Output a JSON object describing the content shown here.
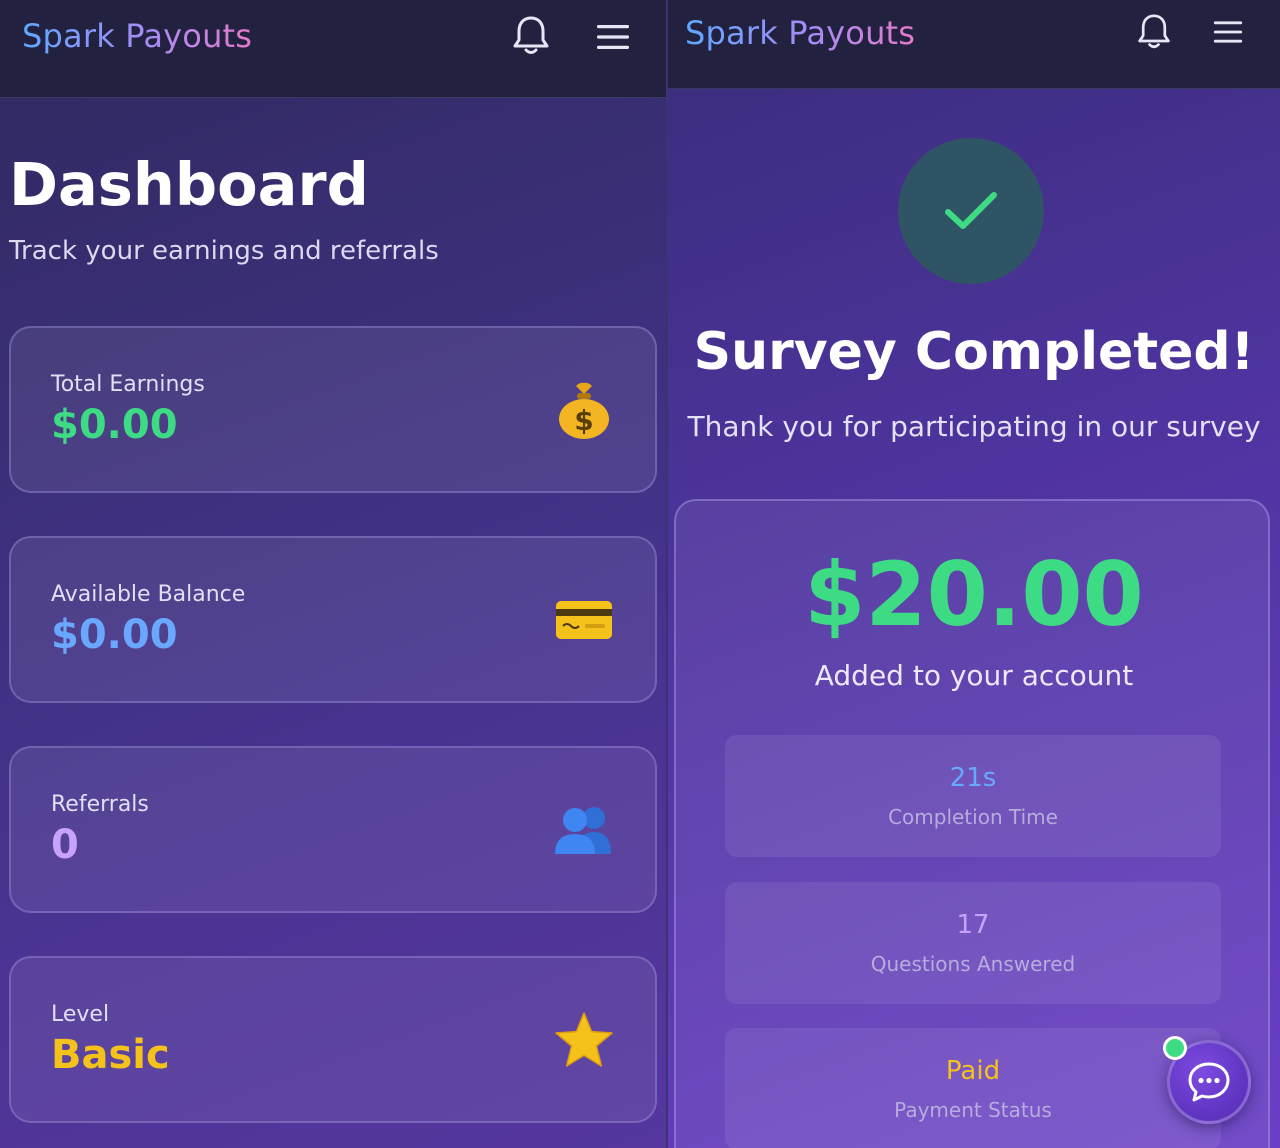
{
  "colors": {
    "green": "#3ddc84",
    "blue": "#6aa7ff",
    "purple": "#c9a2ff",
    "yellow": "#f5c21b",
    "header_bg": "#22213f"
  },
  "dashboard_screen": {
    "brand": "Spark Payouts",
    "header_icons": [
      "bell-icon",
      "menu-icon"
    ],
    "title": "Dashboard",
    "subtitle": "Track your earnings and referrals",
    "stats": [
      {
        "label": "Total Earnings",
        "value": "$0.00",
        "icon": "money-bag-icon"
      },
      {
        "label": "Available Balance",
        "value": "$0.00",
        "icon": "credit-card-icon"
      },
      {
        "label": "Referrals",
        "value": "0",
        "icon": "people-icon"
      },
      {
        "label": "Level",
        "value": "Basic",
        "icon": "star-icon"
      }
    ]
  },
  "survey_screen": {
    "brand": "Spark Payouts",
    "header_icons": [
      "bell-icon",
      "menu-icon"
    ],
    "status_icon": "check-icon",
    "title": "Survey Completed!",
    "subtitle": "Thank you for participating in our survey",
    "amount": "$20.00",
    "amount_note": "Added to your account",
    "details": [
      {
        "value": "21s",
        "label": "Completion Time"
      },
      {
        "value": "17",
        "label": "Questions Answered"
      },
      {
        "value": "Paid",
        "label": "Payment Status"
      }
    ],
    "chat_icon": "chat-icon"
  }
}
